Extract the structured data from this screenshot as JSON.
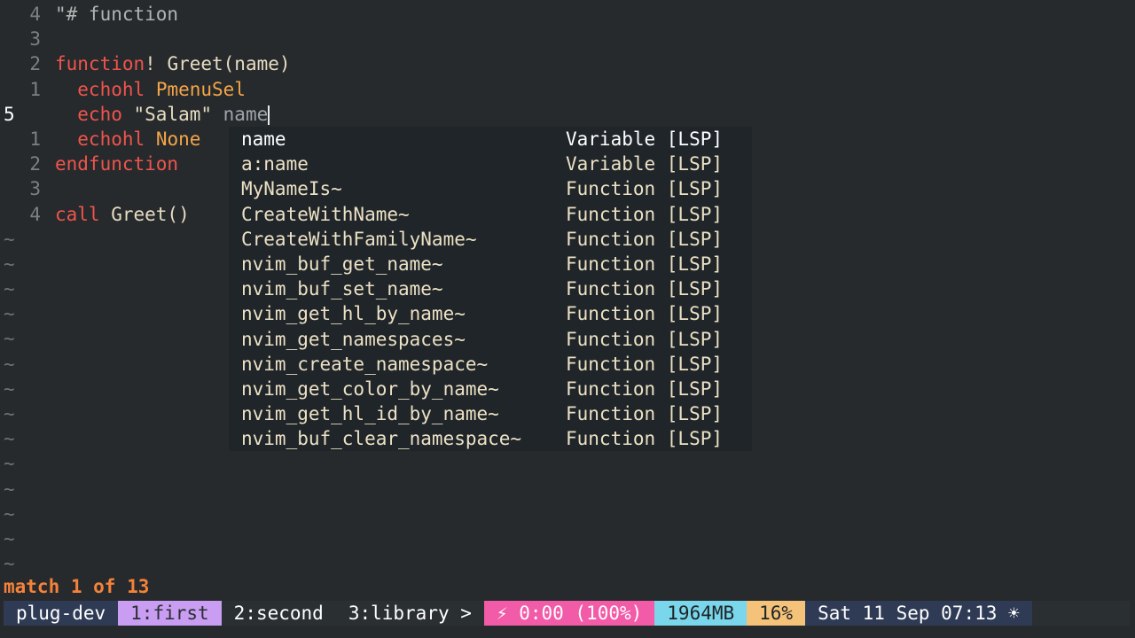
{
  "editor": {
    "lines": [
      {
        "num": "4",
        "parts": [
          {
            "t": "\"# function",
            "c": "cmt"
          }
        ]
      },
      {
        "num": "3",
        "parts": []
      },
      {
        "num": "2",
        "parts": [
          {
            "t": "function",
            "c": "kw"
          },
          {
            "t": "! Greet(name)",
            "c": "fn"
          }
        ]
      },
      {
        "num": "1",
        "parts": [
          {
            "t": "  echohl",
            "c": "kw"
          },
          {
            "t": " ",
            "c": "fn"
          },
          {
            "t": "PmenuSel",
            "c": "id"
          }
        ]
      },
      {
        "num": "5",
        "current": true,
        "parts": [
          {
            "t": "  echo",
            "c": "kw"
          },
          {
            "t": " \"Salam\" ",
            "c": "str"
          },
          {
            "t": "name",
            "c": "var"
          }
        ]
      },
      {
        "num": "1",
        "parts": [
          {
            "t": "  echohl",
            "c": "kw"
          },
          {
            "t": " ",
            "c": "fn"
          },
          {
            "t": "None",
            "c": "id"
          }
        ]
      },
      {
        "num": "2",
        "parts": [
          {
            "t": "endfunction",
            "c": "kw"
          }
        ]
      },
      {
        "num": "3",
        "parts": []
      },
      {
        "num": "4",
        "parts": [
          {
            "t": "call",
            "c": "kw"
          },
          {
            "t": " Greet()",
            "c": "fn"
          }
        ]
      }
    ],
    "tilde": "~",
    "tilde_count": 14
  },
  "completion": {
    "items": [
      {
        "word": "name",
        "kind": "Variable [LSP]"
      },
      {
        "word": "a:name",
        "kind": "Variable [LSP]"
      },
      {
        "word": "MyNameIs~",
        "kind": "Function [LSP]"
      },
      {
        "word": "CreateWithName~",
        "kind": "Function [LSP]"
      },
      {
        "word": "CreateWithFamilyName~",
        "kind": "Function [LSP]"
      },
      {
        "word": "nvim_buf_get_name~",
        "kind": "Function [LSP]"
      },
      {
        "word": "nvim_buf_set_name~",
        "kind": "Function [LSP]"
      },
      {
        "word": "nvim_get_hl_by_name~",
        "kind": "Function [LSP]"
      },
      {
        "word": "nvim_get_namespaces~",
        "kind": "Function [LSP]"
      },
      {
        "word": "nvim_create_namespace~",
        "kind": "Function [LSP]"
      },
      {
        "word": "nvim_get_color_by_name~",
        "kind": "Function [LSP]"
      },
      {
        "word": "nvim_get_hl_id_by_name~",
        "kind": "Function [LSP]"
      },
      {
        "word": "nvim_buf_clear_namespace~",
        "kind": "Function [LSP]"
      }
    ]
  },
  "message": "match 1 of 13",
  "statusbar": {
    "session": "plug-dev",
    "windows": [
      {
        "label": "1:first",
        "active": true
      },
      {
        "label": "2:second",
        "active": false
      },
      {
        "label": "3:library >",
        "active": false
      }
    ],
    "battery": "⚡ 0:00 (100%)",
    "memory": "1964MB",
    "cpu": "16%",
    "clock": "Sat 11 Sep 07:13 ☀"
  }
}
